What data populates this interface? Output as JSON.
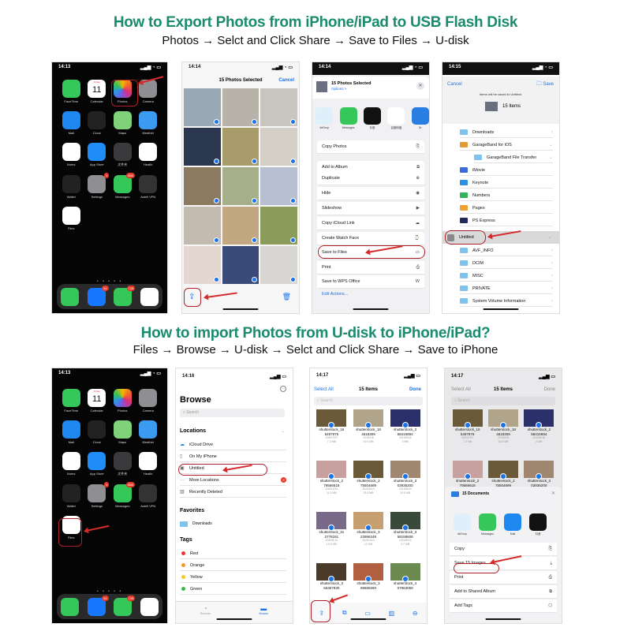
{
  "section1": {
    "title": "How to Export Photos from iPhone/iPad to USB Flash Disk",
    "steps": "Photos →  Selct and Click Share → Save to Files → U-disk"
  },
  "section2": {
    "title": "How to import Photos from U-disk to iPhone/iPad?",
    "steps": "Files → Browse → U-disk → Selct and Click Share → Save to iPhone"
  },
  "home": {
    "time": "14:13",
    "status_icons": "signal wifi battery",
    "calendar_day": "Friday",
    "calendar_date": "11",
    "apps": [
      {
        "label": "FaceTime",
        "icon": "facetime-icon",
        "color": "#35c759"
      },
      {
        "label": "Calendar",
        "icon": "calendar-icon",
        "color": "#ffffff"
      },
      {
        "label": "Photos",
        "icon": "photos-icon",
        "color": "#ffffff"
      },
      {
        "label": "Camera",
        "icon": "camera-icon",
        "color": "#8e8e93"
      },
      {
        "label": "Mail",
        "icon": "mail-icon",
        "color": "#1e88f0"
      },
      {
        "label": "Clock",
        "icon": "clock-icon",
        "color": "#222222"
      },
      {
        "label": "Maps",
        "icon": "maps-icon",
        "color": "#7fd17a"
      },
      {
        "label": "Weather",
        "icon": "weather-icon",
        "color": "#3a9bf0"
      },
      {
        "label": "Notes",
        "icon": "notes-icon",
        "color": "#ffffff"
      },
      {
        "label": "App Store",
        "icon": "app-store-icon",
        "color": "#1f8df5"
      },
      {
        "label": "文件夹",
        "icon": "folder-icon",
        "color": "#3a3a3c"
      },
      {
        "label": "Health",
        "icon": "health-icon",
        "color": "#ffffff"
      },
      {
        "label": "Wallet",
        "icon": "wallet-icon",
        "color": "#222222"
      },
      {
        "label": "Settings",
        "icon": "settings-icon",
        "color": "#8e8e93",
        "badge": "1"
      },
      {
        "label": "Messages",
        "icon": "messages-icon",
        "color": "#35c759",
        "badge": "658"
      },
      {
        "label": "Astrill VPN",
        "icon": "astrill-vpn-icon",
        "color": "#333333"
      },
      {
        "label": "Files",
        "icon": "files-icon",
        "color": "#ffffff"
      }
    ],
    "dock": [
      {
        "icon": "phone-icon",
        "color": "#35c759"
      },
      {
        "icon": "alipay-icon",
        "color": "#1677ff",
        "badge": "61"
      },
      {
        "icon": "wechat-icon",
        "color": "#35c759",
        "badge": "139"
      },
      {
        "icon": "safari-icon",
        "color": "#ffffff"
      }
    ],
    "page_dots": "• • • • •"
  },
  "photos": {
    "time": "14:14",
    "title": "15 Photos Selected",
    "cancel": "Cancel",
    "tile_colors": [
      "#9aa7b5",
      "#b8b3a8",
      "#c9c5bf",
      "#2c3850",
      "#a89c6a",
      "#d4cfc6",
      "#8b7a60",
      "#a5b08b",
      "#b7c0d0",
      "#c3bbb0",
      "#c2a880",
      "#8a9b5a",
      "#e4d6d0",
      "#3a4b7a",
      "#d8d6d2"
    ]
  },
  "share1": {
    "time": "14:14",
    "header_title": "15 Photos Selected",
    "header_sub": "Options >",
    "apps": [
      {
        "label": "AirDrop",
        "icon": "airdrop-icon",
        "color": "#dff0fb"
      },
      {
        "label": "Messages",
        "icon": "messages-icon",
        "color": "#35c759"
      },
      {
        "label": "抖音",
        "icon": "tiktok-icon",
        "color": "#111111"
      },
      {
        "label": "百度网盘",
        "icon": "baidu-netdisk-icon",
        "color": "#ffffff"
      },
      {
        "label": "Dr",
        "icon": "app-icon",
        "color": "#2a7de1"
      }
    ],
    "actions": [
      {
        "label": "Copy Photos",
        "icon": "copy-icon",
        "glyph": "⎘"
      },
      {
        "label": "Add to Album",
        "icon": "album-icon",
        "glyph": "⧉"
      },
      {
        "label": "Duplicate",
        "icon": "duplicate-icon",
        "glyph": "⊕"
      },
      {
        "label": "Hide",
        "icon": "hide-icon",
        "glyph": "◉"
      },
      {
        "label": "Slideshow",
        "icon": "play-icon",
        "glyph": "▶"
      },
      {
        "label": "Copy iCloud Link",
        "icon": "cloud-icon",
        "glyph": "☁"
      },
      {
        "label": "Create Watch Face",
        "icon": "watch-icon",
        "glyph": "⌚"
      },
      {
        "label": "Save to Files",
        "icon": "folder-icon",
        "glyph": "▭"
      },
      {
        "label": "Print",
        "icon": "print-icon",
        "glyph": "⎙"
      },
      {
        "label": "Save to WPS Office",
        "icon": "wps-icon",
        "glyph": "W"
      }
    ],
    "edit_actions": "Edit Actions..."
  },
  "savefiles": {
    "time": "14:15",
    "cancel": "Cancel",
    "save": "Save",
    "note": "Items will be saved to Untitled.",
    "count": "15 Items",
    "folders": [
      {
        "label": "Downloads",
        "indent": 0,
        "chev": "›",
        "color": "#7ec3ee"
      },
      {
        "label": "GarageBand for iOS",
        "indent": 0,
        "chev": "⌄",
        "color": "#e59a3a"
      },
      {
        "label": "GarageBand File Transfer",
        "indent": 1,
        "chev": "⌄",
        "color": "#7ec3ee"
      },
      {
        "label": "iMovie",
        "indent": 0,
        "chev": "",
        "color": "#3a6bd8"
      },
      {
        "label": "Keynote",
        "indent": 0,
        "chev": "",
        "color": "#2f8fe0"
      },
      {
        "label": "Numbers",
        "indent": 0,
        "chev": "",
        "color": "#34b35a"
      },
      {
        "label": "Pages",
        "indent": 0,
        "chev": "",
        "color": "#f0a030"
      },
      {
        "label": "PS Express",
        "indent": 0,
        "chev": "",
        "color": "#1d2a5a"
      }
    ],
    "drive": "Untitled",
    "drive_folders": [
      "AVF_INFO",
      "DCIM",
      "MISC",
      "PRIVATE",
      "System Volume Information"
    ]
  },
  "browse": {
    "time": "14:16",
    "title": "Browse",
    "search_placeholder": "Search",
    "locations_label": "Locations",
    "locations": [
      {
        "label": "iCloud Drive",
        "icon": "icloud-icon"
      },
      {
        "label": "On My iPhone",
        "icon": "iphone-icon"
      },
      {
        "label": "Untitled",
        "icon": "usb-drive-icon"
      },
      {
        "label": "More Locations",
        "icon": "more-icon",
        "badge": "3"
      },
      {
        "label": "Recently Deleted",
        "icon": "trash-icon"
      }
    ],
    "favorites_label": "Favorites",
    "favorites": [
      "Downloads"
    ],
    "tags_label": "Tags",
    "tags": [
      {
        "label": "Red",
        "color": "#e53935"
      },
      {
        "label": "Orange",
        "color": "#f29a2e"
      },
      {
        "label": "Yellow",
        "color": "#f2c92e"
      },
      {
        "label": "Green",
        "color": "#3bb54a"
      }
    ],
    "tabs": [
      {
        "label": "Recents",
        "icon": "clock-icon"
      },
      {
        "label": "Browse",
        "icon": "folder-icon"
      }
    ]
  },
  "items": {
    "time": "14:17",
    "select_all": "Select All",
    "title": "15 Items",
    "done": "Done",
    "search_placeholder": "Search",
    "files": [
      {
        "name": "shutterstock_16\n5497876",
        "date": "2020/7/07",
        "size": "7.3 MB",
        "color": "#6b5a3a"
      },
      {
        "name": "shutterstock_18\n4619309",
        "date": "2019/1/8",
        "size": "10.6 MB",
        "color": "#b0a48a"
      },
      {
        "name": "shutterstock_2\n58416894",
        "date": "2019/6/18",
        "size": "2 MB",
        "color": "#2b2f6a"
      },
      {
        "name": "shutterstock_2\n79566618",
        "date": "2020/12/4",
        "size": "11.5 MB",
        "color": "#c9a0a0"
      },
      {
        "name": "shutterstock_2\n75504699",
        "date": "2020/6/12",
        "size": "23.9 MB",
        "color": "#6a5a38"
      },
      {
        "name": "shutterstock_3\n03936200",
        "date": "2019/8/29",
        "size": "10.5 MB",
        "color": "#a08870"
      },
      {
        "name": "shutterstock_31\n2778151",
        "date": "2020/8/19",
        "size": "10.9 MB",
        "color": "#7a6a8a"
      },
      {
        "name": "shutterstock_3\n23956348",
        "date": "2020/4/23",
        "size": "12 MB",
        "color": "#c6a070"
      },
      {
        "name": "shutterstock_3\n58158608",
        "date": "2020/8/19",
        "size": "9.7 MB",
        "color": "#3a4a3a"
      },
      {
        "name": "shutterstock_3\n66357930",
        "date": "",
        "size": "",
        "color": "#4a3a2a"
      },
      {
        "name": "shutterstock_3\n89659290",
        "date": "",
        "size": "",
        "color": "#b06040"
      },
      {
        "name": "shutterstock_4\n07963059",
        "date": "",
        "size": "",
        "color": "#6a8a50"
      }
    ],
    "toolbar": [
      "share-icon",
      "duplicate-icon",
      "folder-icon",
      "trash-icon",
      "more-icon"
    ]
  },
  "share2": {
    "time": "14:17",
    "select_all": "Select All",
    "title": "15 Items",
    "done": "Done",
    "search_placeholder": "Search",
    "sheet_title": "15 Documents",
    "apps": [
      {
        "label": "AirDrop",
        "icon": "airdrop-icon",
        "color": "#dff0fb"
      },
      {
        "label": "Messages",
        "icon": "messages-icon",
        "color": "#35c759"
      },
      {
        "label": "Mail",
        "icon": "mail-icon",
        "color": "#1e88f0"
      },
      {
        "label": "抖音",
        "icon": "tiktok-icon",
        "color": "#111111"
      }
    ],
    "actions": [
      {
        "label": "Copy",
        "icon": "copy-icon",
        "glyph": "⎘"
      },
      {
        "label": "Save 15 Images",
        "icon": "save-image-icon",
        "glyph": "⤓"
      },
      {
        "label": "Print",
        "icon": "print-icon",
        "glyph": "⎙"
      },
      {
        "label": "Add to Shared Album",
        "icon": "album-icon",
        "glyph": "⧉"
      },
      {
        "label": "Add Tags",
        "icon": "tag-icon",
        "glyph": "⬡"
      }
    ]
  }
}
